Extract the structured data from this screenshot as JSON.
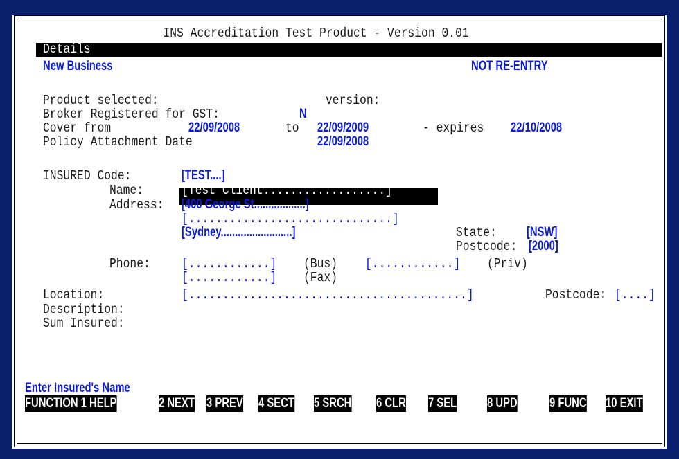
{
  "window": {
    "title": "INS Accreditation Test Product - Version 0.01"
  },
  "header": {
    "section": "Details",
    "mode": "New Business",
    "entry_status": "NOT RE-ENTRY"
  },
  "policy": {
    "product_label": "Product selected:",
    "version_label": "version:",
    "gst_label": "Broker Registered for GST:",
    "gst_value": "N",
    "cover_label": "Cover from",
    "cover_from": "22/09/2008",
    "to_label": "to",
    "cover_to": "22/09/2009",
    "expires_label": "- expires",
    "expires": "22/10/2008",
    "attach_label": "Policy Attachment Date",
    "attach_date": "22/09/2008"
  },
  "insured": {
    "code_label": "INSURED Code:",
    "code_value": "[TEST....]",
    "name_label": "Name:",
    "name_value": "[Test Client..................]",
    "address_label": "Address:",
    "address1": "[400 George St..................]",
    "address2": "[..............................]",
    "address3": "[Sydney.........................]",
    "state_label": "State:",
    "state_value": "[NSW]",
    "postcode_label": "Postcode:",
    "postcode_value": "[2000]",
    "phone_label": "Phone:",
    "phone_bus": "[............]",
    "bus_label": "(Bus)",
    "phone_priv": "[............]",
    "priv_label": "(Priv)",
    "phone_fax": "[............]",
    "fax_label": "(Fax)"
  },
  "risk": {
    "location_label": "Location:",
    "location_value": "[.........................................]",
    "loc_postcode_label": "Postcode:",
    "loc_postcode_value": "[....]",
    "description_label": "Description:",
    "sum_label": "Sum Insured:"
  },
  "status": {
    "prompt": "Enter Insured's Name"
  },
  "function_keys": [
    "FUNCTION 1 HELP",
    "2 NEXT",
    "3 PREV",
    "4 SECT",
    "5 SRCH",
    "6 CLR",
    "7 SEL",
    "8 UPD",
    "9 FUNC",
    "10 EXIT"
  ],
  "colors": {
    "background": "#0a1f6b",
    "screen": "#ffffff",
    "field": "#0b1bd8"
  }
}
